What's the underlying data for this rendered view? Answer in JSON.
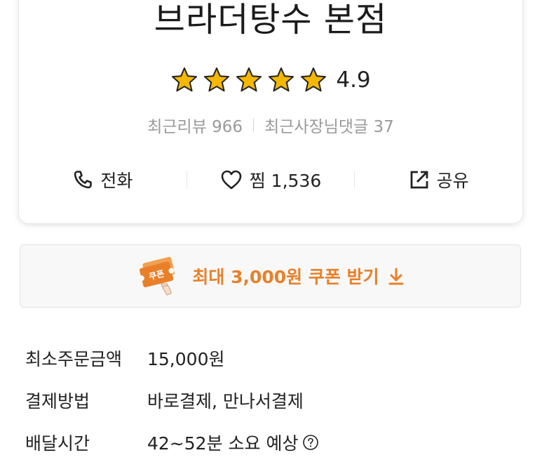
{
  "store": {
    "name": "브라더탕수 본점",
    "rating": "4.9",
    "star_count": 5,
    "star_color": "#f5b800",
    "review_label": "최근리뷰 966",
    "reply_label": "최근사장님댓글 37"
  },
  "actions": {
    "call_label": "전화",
    "favorite_label": "찜 1,536",
    "share_label": "공유",
    "call_icon": "phone-icon",
    "favorite_icon": "heart-icon",
    "share_icon": "share-icon"
  },
  "coupon": {
    "label": "최대 3,000원 쿠폰 받기",
    "ticket_text": "쿠폰",
    "accent_color": "#e8802a"
  },
  "info": {
    "rows": [
      {
        "label": "최소주문금액",
        "value": "15,000원"
      },
      {
        "label": "결제방법",
        "value": "바로결제, 만나서결제"
      },
      {
        "label": "배달시간",
        "value": "42~52분 소요 예상"
      }
    ]
  }
}
